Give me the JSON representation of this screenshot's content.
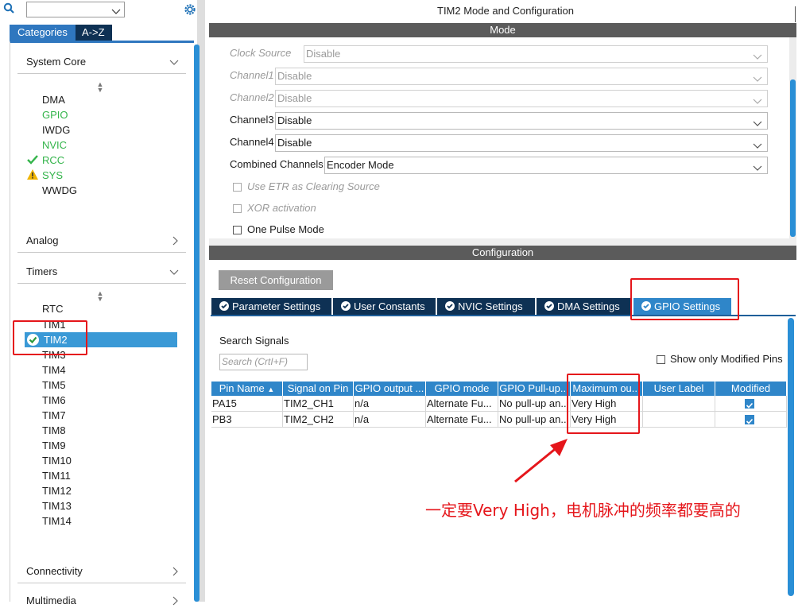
{
  "left_panel": {
    "search": {
      "value": "",
      "placeholder": ""
    },
    "tabs": [
      "Categories",
      "A->Z"
    ],
    "categories": [
      {
        "label": "System Core",
        "expanded": true,
        "items": [
          {
            "label": "DMA",
            "status": "none"
          },
          {
            "label": "GPIO",
            "status": "configured"
          },
          {
            "label": "IWDG",
            "status": "none"
          },
          {
            "label": "NVIC",
            "status": "configured"
          },
          {
            "label": "RCC",
            "status": "ok"
          },
          {
            "label": "SYS",
            "status": "warning"
          },
          {
            "label": "WWDG",
            "status": "none"
          }
        ]
      },
      {
        "label": "Analog",
        "expanded": false
      },
      {
        "label": "Timers",
        "expanded": true,
        "items": [
          {
            "label": "RTC"
          },
          {
            "label": "TIM1"
          },
          {
            "label": "TIM2",
            "selected": true
          },
          {
            "label": "TIM3"
          },
          {
            "label": "TIM4"
          },
          {
            "label": "TIM5"
          },
          {
            "label": "TIM6"
          },
          {
            "label": "TIM7"
          },
          {
            "label": "TIM8"
          },
          {
            "label": "TIM9"
          },
          {
            "label": "TIM10"
          },
          {
            "label": "TIM11"
          },
          {
            "label": "TIM12"
          },
          {
            "label": "TIM13"
          },
          {
            "label": "TIM14"
          }
        ]
      },
      {
        "label": "Connectivity",
        "expanded": false
      },
      {
        "label": "Multimedia",
        "expanded": false
      }
    ]
  },
  "main": {
    "title": "TIM2 Mode and Configuration",
    "mode_header": "Mode",
    "mode_rows": [
      {
        "label": "Clock Source",
        "value": "Disable",
        "disabled": true
      },
      {
        "label": "Channel1",
        "value": "Disable",
        "disabled": true
      },
      {
        "label": "Channel2",
        "value": "Disable",
        "disabled": true
      },
      {
        "label": "Channel3",
        "value": "Disable",
        "disabled": false
      },
      {
        "label": "Channel4",
        "value": "Disable",
        "disabled": false
      },
      {
        "label": "Combined Channels",
        "value": "Encoder Mode",
        "disabled": false
      }
    ],
    "mode_checkboxes": [
      {
        "label": "Use ETR as Clearing Source",
        "checked": false,
        "disabled": true
      },
      {
        "label": "XOR activation",
        "checked": false,
        "disabled": true
      },
      {
        "label": "One Pulse Mode",
        "checked": false,
        "disabled": false
      }
    ],
    "config_header": "Configuration",
    "reset_button": "Reset Configuration",
    "config_tabs": [
      {
        "label": "Parameter Settings",
        "active": false
      },
      {
        "label": "User Constants",
        "active": false
      },
      {
        "label": "NVIC Settings",
        "active": false
      },
      {
        "label": "DMA Settings",
        "active": false
      },
      {
        "label": "GPIO Settings",
        "active": true
      }
    ],
    "search_signals_label": "Search Signals",
    "search_signals_placeholder": "Search (CrtI+F)",
    "show_only_modified_label": "Show only Modified Pins",
    "show_only_modified_checked": false,
    "gpio_table": {
      "headers": [
        "Pin Name",
        "Signal on Pin",
        "GPIO output ...",
        "GPIO mode",
        "GPIO Pull-up...",
        "Maximum ou...",
        "User Label",
        "Modified"
      ],
      "rows": [
        {
          "pin": "PA15",
          "signal": "TIM2_CH1",
          "output": "n/a",
          "mode": "Alternate Fu...",
          "pull": "No pull-up an...",
          "max": "Very High",
          "user_label": "",
          "modified": true
        },
        {
          "pin": "PB3",
          "signal": "TIM2_CH2",
          "output": "n/a",
          "mode": "Alternate Fu...",
          "pull": "No pull-up an...",
          "max": "Very High",
          "user_label": "",
          "modified": true
        }
      ]
    },
    "annotation": "一定要Very High，电机脉冲的频率都要高的"
  },
  "colors": {
    "accent_blue": "#2f86c9",
    "dark_navy": "#0e3154",
    "green": "#33b44a",
    "warning": "#f0b400",
    "annotation_red": "#e5161b"
  }
}
